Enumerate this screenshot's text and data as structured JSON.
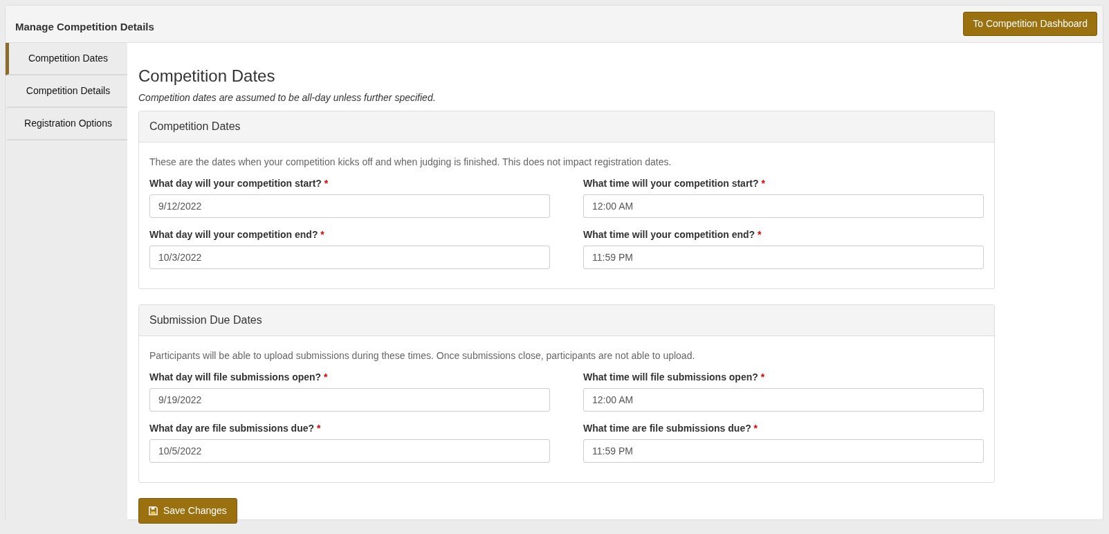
{
  "header": {
    "title": "Manage Competition Details",
    "dashboard_button": "To Competition Dashboard"
  },
  "sidebar": {
    "items": [
      {
        "label": "Competition Dates",
        "selected": true
      },
      {
        "label": "Competition Details",
        "selected": false
      },
      {
        "label": "Registration Options",
        "selected": false
      }
    ]
  },
  "page": {
    "title": "Competition Dates",
    "note": "Competition dates are assumed to be all-day unless further specified."
  },
  "sections": [
    {
      "title": "Competition Dates",
      "description": "These are the dates when your competition kicks off and when judging is finished. This does not impact registration dates.",
      "fields": [
        {
          "label": "What day will your competition start?",
          "required_mark": "*",
          "value": "9/12/2022"
        },
        {
          "label": "What time will your competition start?",
          "required_mark": "*",
          "value": "12:00 AM"
        },
        {
          "label": "What day will your competition end?",
          "required_mark": "*",
          "value": "10/3/2022"
        },
        {
          "label": "What time will your competition end?",
          "required_mark": "*",
          "value": "11:59 PM"
        }
      ]
    },
    {
      "title": "Submission Due Dates",
      "description": "Participants will be able to upload submissions during these times. Once submissions close, participants are not able to upload.",
      "fields": [
        {
          "label": "What day will file submissions open?",
          "required_mark": "*",
          "value": "9/19/2022"
        },
        {
          "label": "What time will file submissions open?",
          "required_mark": "*",
          "value": "12:00 AM"
        },
        {
          "label": "What day are file submissions due?",
          "required_mark": "*",
          "value": "10/5/2022"
        },
        {
          "label": "What time are file submissions due?",
          "required_mark": "*",
          "value": "11:59 PM"
        }
      ]
    }
  ],
  "save_button": "Save Changes"
}
